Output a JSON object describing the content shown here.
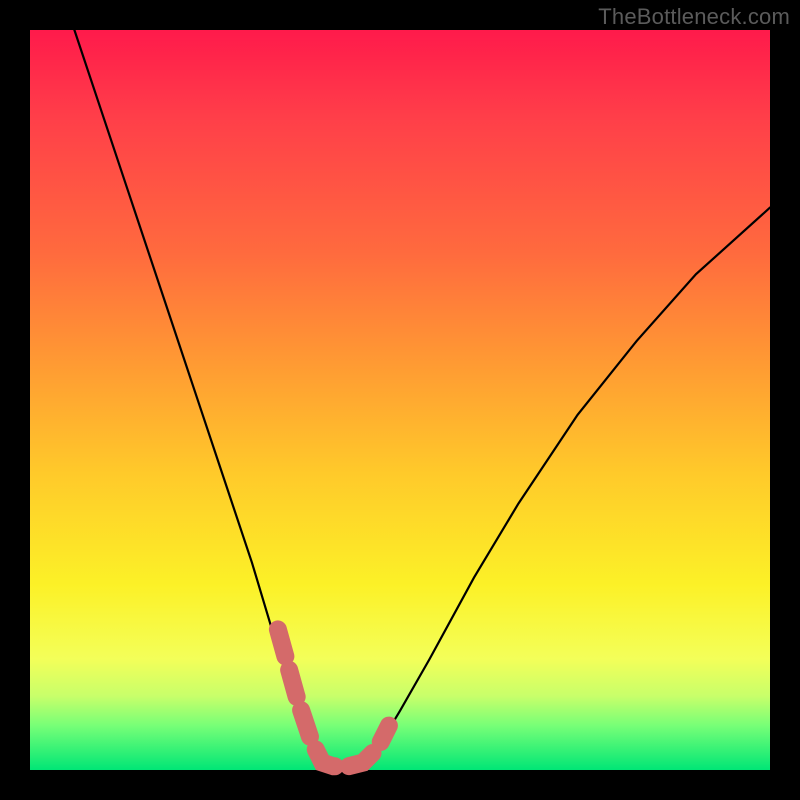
{
  "watermark": "TheBottleneck.com",
  "chart_data": {
    "type": "line",
    "title": "",
    "xlabel": "",
    "ylabel": "",
    "xlim": [
      0,
      100
    ],
    "ylim": [
      0,
      100
    ],
    "grid": false,
    "legend": false,
    "series": [
      {
        "name": "bottleneck-curve",
        "color": "#000000",
        "x": [
          6,
          10,
          14,
          18,
          22,
          26,
          30,
          33,
          36,
          38,
          39.5,
          41,
          43,
          45,
          47,
          50,
          54,
          60,
          66,
          74,
          82,
          90,
          100
        ],
        "y": [
          100,
          88,
          76,
          64,
          52,
          40,
          28,
          18,
          10,
          4,
          1,
          0.5,
          0.5,
          1,
          3,
          8,
          15,
          26,
          36,
          48,
          58,
          67,
          76
        ]
      },
      {
        "name": "highlight-band",
        "color": "#d46a6a",
        "x": [
          33.5,
          36,
          38,
          39.5,
          41,
          43,
          45,
          47,
          48.5
        ],
        "y": [
          19,
          10,
          4,
          1,
          0.5,
          0.5,
          1,
          3,
          6
        ]
      }
    ],
    "annotations": []
  },
  "colors": {
    "curve": "#000000",
    "highlight": "#d46a6a",
    "background_top": "#ff1a4b",
    "background_bottom": "#00e676",
    "frame": "#000000"
  }
}
